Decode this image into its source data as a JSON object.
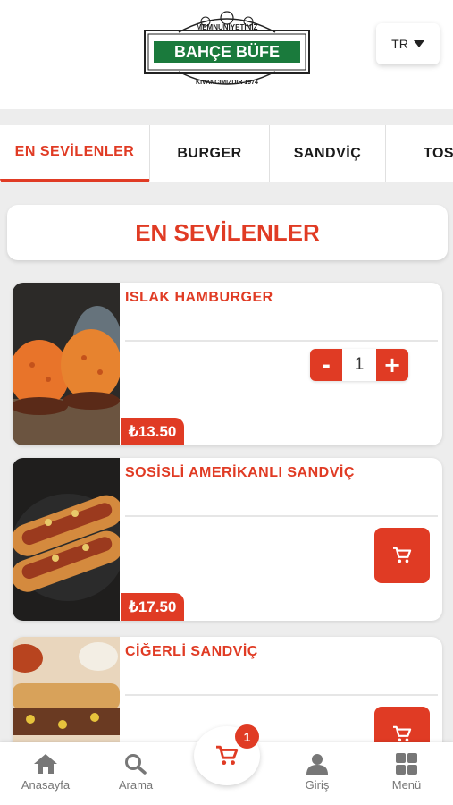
{
  "header": {
    "logo": {
      "top_text": "MEMNUNİYETİNİZ",
      "brand": "BAHÇE BÜFE",
      "bottom_text": "KIVANCIMIZDIR 1974"
    },
    "language": "TR"
  },
  "tabs": [
    {
      "label": "EN SEVİLENLER",
      "active": true
    },
    {
      "label": "BURGER",
      "active": false
    },
    {
      "label": "SANDVİÇ",
      "active": false
    },
    {
      "label": "TOS",
      "active": false
    }
  ],
  "section_title": "EN SEVİLENLER",
  "products": [
    {
      "name": "ISLAK HAMBURGER",
      "price": "₺13.50",
      "quantity": "1",
      "minus_label": "-",
      "plus_label": "+",
      "image_icon": "burger-photo"
    },
    {
      "name": "SOSİSLİ AMERİKANLI SANDVİÇ",
      "price": "₺17.50",
      "image_icon": "hotdog-photo"
    },
    {
      "name": "CİĞERLİ SANDVİÇ",
      "price": "",
      "image_icon": "sandwich-photo"
    }
  ],
  "bottom_nav": {
    "home": "Anasayfa",
    "search": "Arama",
    "cart_count": "1",
    "login": "Giriş",
    "menu": "Menü"
  },
  "colors": {
    "accent": "#e03b24",
    "logo_green": "#1a7a3c"
  }
}
